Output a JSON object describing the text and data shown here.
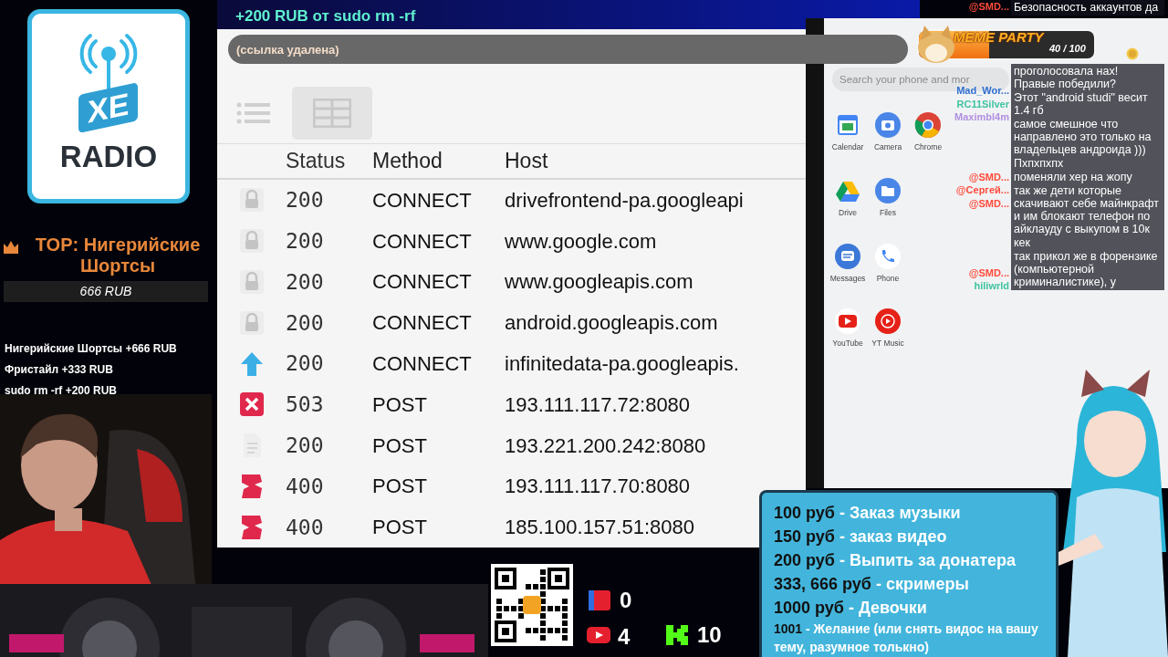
{
  "alert": {
    "amount": "+200 RUB",
    "from": "от",
    "donor": "sudo rm -rf"
  },
  "logo": {
    "badge": "XE",
    "name": "RADIO"
  },
  "top_donor": {
    "title": "TOP: Нигерийские Шортсы",
    "amount": "666 RUB"
  },
  "donations": [
    "Нигерийские Шортсы +666 RUB",
    "Фристайл +333 RUB",
    "sudo rm -rf +200 RUB"
  ],
  "address_bar": {
    "value": "(ссылка удалена)"
  },
  "view_buttons": [
    {
      "kind": "list",
      "selected": false
    },
    {
      "kind": "grid",
      "selected": true
    }
  ],
  "table": {
    "columns": [
      "Status",
      "Method",
      "Host"
    ],
    "rows": [
      {
        "kind": "lock",
        "status": "200",
        "method": "CONNECT",
        "host": "drivefrontend-pa.googleapi"
      },
      {
        "kind": "lock",
        "status": "200",
        "method": "CONNECT",
        "host": "www.google.com"
      },
      {
        "kind": "lock",
        "status": "200",
        "method": "CONNECT",
        "host": "www.googleapis.com"
      },
      {
        "kind": "lock",
        "status": "200",
        "method": "CONNECT",
        "host": "android.googleapis.com"
      },
      {
        "kind": "upload",
        "status": "200",
        "method": "CONNECT",
        "host": "infinitedata-pa.googleapis."
      },
      {
        "kind": "error",
        "status": "503",
        "method": "POST",
        "host": "193.111.117.72:8080"
      },
      {
        "kind": "document",
        "status": "200",
        "method": "POST",
        "host": "193.221.200.242:8080"
      },
      {
        "kind": "broken",
        "status": "400",
        "method": "POST",
        "host": "193.111.117.70:8080"
      },
      {
        "kind": "broken",
        "status": "400",
        "method": "POST",
        "host": "185.100.157.51:8080"
      }
    ]
  },
  "phone": {
    "search": {
      "placeholder": "Search your phone and mor"
    },
    "apps": [
      {
        "kind": "calendar",
        "label": "Calendar"
      },
      {
        "kind": "camera",
        "label": "Camera"
      },
      {
        "kind": "chrome",
        "label": "Chrome"
      },
      {
        "kind": "drive",
        "label": "Drive"
      },
      {
        "kind": "files",
        "label": "Files"
      },
      {
        "kind": "none"
      },
      {
        "kind": "messages",
        "label": "Messages"
      },
      {
        "kind": "phone",
        "label": "Phone"
      },
      {
        "kind": "none"
      },
      {
        "kind": "youtube",
        "label": "YouTube"
      },
      {
        "kind": "ytmusic",
        "label": "YT Music"
      }
    ]
  },
  "goal": {
    "title": "MEME PARTY",
    "reading": "40 / 100",
    "level": 0.4
  },
  "chat_names": [
    [
      "@SMD..."
    ],
    [
      "Mad_Wor...",
      "RC11Silver",
      "Maximbl4m"
    ],
    [
      "@SMD...",
      "@Сергей...",
      "@SMD..."
    ],
    [
      "@SMD...",
      "hiliwrld"
    ]
  ],
  "chat_messages": [
    "Безопасность аккаунтов да",
    "проголосовала нах! Правые победили?",
    "Этот \"android studi\" весит 1.4 гб",
    "самое смешное что направлено это только на владельцев андроида )))",
    "Пхпхпхпх",
    "поменяли хер на жопу",
    "так же дети которые скачивают себе майнкрафт и им блокают телефон по айклауду с выкупом в 10к",
    "кек",
    "так прикол же в форензике (компьютерной криминалистике), у"
  ],
  "prices": [
    {
      "kind": "price",
      "price": "100 руб",
      "item": "- Заказ музыки"
    },
    {
      "kind": "price",
      "price": "150 руб",
      "item": "- заказ видео"
    },
    {
      "kind": "price",
      "price": "200 руб",
      "item": "- Выпить за донатера"
    },
    {
      "kind": "price",
      "price": "333, 666 руб",
      "item": "- скримеры"
    },
    {
      "kind": "price",
      "price": "1000 руб",
      "item": "- Девочки"
    },
    {
      "kind": "note",
      "price": "1001",
      "item": "- Желание (или снять видос на вашу тему, разумное толькно)"
    }
  ],
  "counters": [
    {
      "kind": "live",
      "value": "0"
    },
    {
      "kind": "youtube",
      "value": "4"
    },
    {
      "kind": "kick",
      "value": "10"
    }
  ]
}
